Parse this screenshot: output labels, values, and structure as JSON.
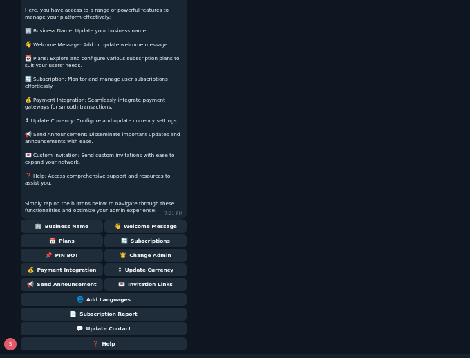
{
  "message": {
    "intro": "Here, you have access to a range of powerful features to manage your platform effectively:",
    "features": [
      {
        "icon": "🏢",
        "text": "Business Name: Update your business name."
      },
      {
        "icon": "👋",
        "text": "Welcome Message: Add or update welcome message."
      },
      {
        "icon": "📆",
        "text": "Plans: Explore and configure various subscription plans to suit your users' needs."
      },
      {
        "icon": "🔄",
        "text": "Subscription: Monitor and manage user subscriptions effortlessly."
      },
      {
        "icon": "💰",
        "text": "Payment Integration: Seamlessly integrate payment gateways for smooth transactions."
      },
      {
        "icon": "↕",
        "text": "Update Currency: Configure and update currency settings."
      },
      {
        "icon": "📢",
        "text": "Send Announcement: Disseminate important updates and announcements with ease."
      },
      {
        "icon": "💌",
        "text": "Custom Invitation: Send custom invitations with ease to expand your network."
      },
      {
        "icon": "❓",
        "text": "Help: Access comprehensive support and resources to assist you."
      }
    ],
    "outro": "Simply tap on the buttons below to navigate through these functionalities and optimize your admin experience:",
    "time": "7:21 PM"
  },
  "keyboard": {
    "business_name": {
      "icon": "🏢",
      "label": "Business Name"
    },
    "welcome_message": {
      "icon": "👋",
      "label": "Welcome Message"
    },
    "plans": {
      "icon": "📆",
      "label": "Plans"
    },
    "subscriptions": {
      "icon": "🔄",
      "label": "Subscriptions"
    },
    "pin_bot": {
      "icon": "📌",
      "label": "PIN BOT"
    },
    "change_admin": {
      "icon": "🤴",
      "label": "Change Admin"
    },
    "payment_integration": {
      "icon": "💰",
      "label": "Payment Integration"
    },
    "update_currency": {
      "icon": "↕",
      "label": "Update Currency"
    },
    "send_announcement": {
      "icon": "📢",
      "label": "Send Announcement"
    },
    "invitation_links": {
      "icon": "💌",
      "label": "Invitation Links"
    },
    "add_languages": {
      "icon": "🌐",
      "label": "Add Languages"
    },
    "subscription_report": {
      "icon": "📄",
      "label": "Subscription Report"
    },
    "update_contact": {
      "icon": "💬",
      "label": "Update Contact"
    },
    "help": {
      "icon": "❓",
      "label": "Help"
    }
  },
  "avatar": {
    "initial": "S"
  }
}
